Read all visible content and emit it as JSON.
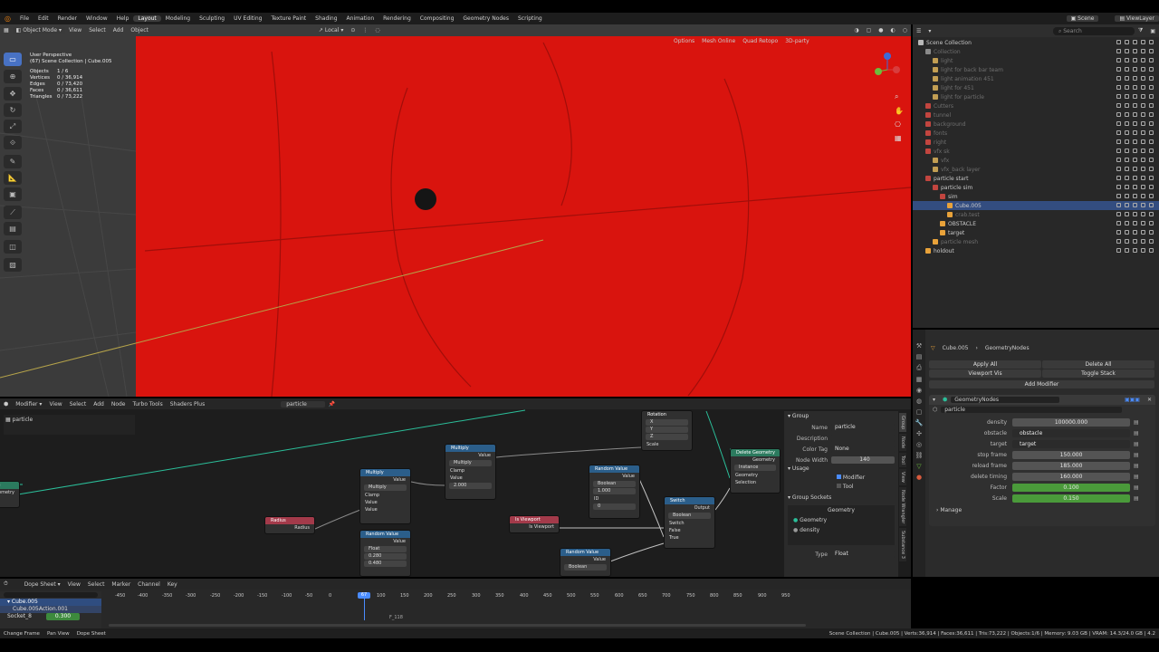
{
  "menu": {
    "items": [
      "File",
      "Edit",
      "Render",
      "Window",
      "Help"
    ]
  },
  "workspaces": [
    "Layout",
    "Modeling",
    "Sculpting",
    "UV Editing",
    "Texture Paint",
    "Shading",
    "Animation",
    "Rendering",
    "Compositing",
    "Geometry Nodes",
    "Scripting"
  ],
  "active_workspace": "Layout",
  "top_right": {
    "scene": "Scene",
    "view_layer": "ViewLayer"
  },
  "viewport": {
    "mode": "Object Mode",
    "menus": [
      "View",
      "Select",
      "Add",
      "Object"
    ],
    "orientation": "Local",
    "right_buttons": [
      "Options",
      "Mesh Online",
      "Quad Retopo",
      "3D-party"
    ],
    "perspective": "User Perspective",
    "collection": "(67) Scene Collection | Cube.005",
    "stats": [
      [
        "Objects",
        "1 / 6"
      ],
      [
        "Vertices",
        "0 / 36,914"
      ],
      [
        "Edges",
        "0 / 73,420"
      ],
      [
        "Faces",
        "0 / 36,611"
      ],
      [
        "Triangles",
        "0 / 73,222"
      ]
    ],
    "bg_color": "#d9140e"
  },
  "outliner": {
    "search_placeholder": "Search",
    "items": [
      {
        "label": "Scene Collection",
        "indent": 0,
        "muted": false,
        "sel": false,
        "color": "#b8b8b8"
      },
      {
        "label": "Collection",
        "indent": 1,
        "muted": true,
        "sel": false,
        "color": "#8a8a8a"
      },
      {
        "label": "light",
        "indent": 2,
        "muted": true,
        "sel": false,
        "color": "#c29e53"
      },
      {
        "label": "light for back bar team",
        "indent": 2,
        "muted": true,
        "sel": false,
        "color": "#c29e53"
      },
      {
        "label": "light animation 451",
        "indent": 2,
        "muted": true,
        "sel": false,
        "color": "#c29e53"
      },
      {
        "label": "light for 451",
        "indent": 2,
        "muted": true,
        "sel": false,
        "color": "#c29e53"
      },
      {
        "label": "light for particle",
        "indent": 2,
        "muted": true,
        "sel": false,
        "color": "#c29e53"
      },
      {
        "label": "Cutters",
        "indent": 1,
        "muted": true,
        "sel": false,
        "color": "#c2453f"
      },
      {
        "label": "tunnel",
        "indent": 1,
        "muted": true,
        "sel": false,
        "color": "#c2453f"
      },
      {
        "label": "background",
        "indent": 1,
        "muted": true,
        "sel": false,
        "color": "#c2453f"
      },
      {
        "label": "fonts",
        "indent": 1,
        "muted": true,
        "sel": false,
        "color": "#c2453f"
      },
      {
        "label": "right",
        "indent": 1,
        "muted": true,
        "sel": false,
        "color": "#c2453f"
      },
      {
        "label": "vfx sk",
        "indent": 1,
        "muted": true,
        "sel": false,
        "color": "#c2453f"
      },
      {
        "label": "vfx",
        "indent": 2,
        "muted": true,
        "sel": false,
        "color": "#c29e53"
      },
      {
        "label": "vfx_back layer",
        "indent": 2,
        "muted": true,
        "sel": false,
        "color": "#c29e53"
      },
      {
        "label": "particle start",
        "indent": 1,
        "muted": false,
        "sel": false,
        "color": "#c2453f"
      },
      {
        "label": "particle sim",
        "indent": 2,
        "muted": false,
        "sel": false,
        "color": "#c2453f"
      },
      {
        "label": "sim",
        "indent": 3,
        "muted": false,
        "sel": false,
        "color": "#c2453f"
      },
      {
        "label": "Cube.005",
        "indent": 4,
        "muted": false,
        "sel": true,
        "color": "#e8a23a"
      },
      {
        "label": "crab.test",
        "indent": 4,
        "muted": true,
        "sel": false,
        "color": "#e8a23a"
      },
      {
        "label": "OBSTACLE",
        "indent": 3,
        "muted": false,
        "sel": false,
        "color": "#e8a23a"
      },
      {
        "label": "target",
        "indent": 3,
        "muted": false,
        "sel": false,
        "color": "#e8a23a"
      },
      {
        "label": "particle mesh",
        "indent": 2,
        "muted": true,
        "sel": false,
        "color": "#e8a23a"
      },
      {
        "label": "holdout",
        "indent": 1,
        "muted": false,
        "sel": false,
        "color": "#e8a23a"
      }
    ]
  },
  "properties": {
    "object": "Cube.005",
    "modifier_tab": "GeometryNodes",
    "apply_all": "Apply All",
    "delete_all": "Delete All",
    "viewport_vis": "Viewport Vis",
    "toggle_stack": "Toggle Stack",
    "add_modifier": "Add Modifier",
    "modifier_name": "GeometryNodes",
    "node_group": "particle",
    "inputs": [
      {
        "label": "density",
        "value": "100000.000",
        "kind": "num"
      },
      {
        "label": "obstacle",
        "value": "obstacle",
        "kind": "field"
      },
      {
        "label": "target",
        "value": "target",
        "kind": "field"
      },
      {
        "label": "stop frame",
        "value": "150.000",
        "kind": "num"
      },
      {
        "label": "reload frame",
        "value": "185.000",
        "kind": "num"
      },
      {
        "label": "delete timing",
        "value": "160.000",
        "kind": "num"
      },
      {
        "label": "Factor",
        "value": "0.100",
        "kind": "bar"
      },
      {
        "label": "Scale",
        "value": "0.150",
        "kind": "bar"
      }
    ],
    "manage": "Manage"
  },
  "node_editor": {
    "editor_type": "Modifier",
    "menus": [
      "View",
      "Select",
      "Add",
      "Node",
      "Turbo Tools",
      "Shaders Plus"
    ],
    "group": "particle",
    "breadcrumb": "particle",
    "side_panel": {
      "group_header": "Group",
      "name_label": "Name",
      "name_value": "particle",
      "desc_label": "Description",
      "color_tag_label": "Color Tag",
      "color_tag_value": "None",
      "node_width_label": "Node Width",
      "node_width_value": "140",
      "usage": "Usage",
      "modifier": "Modifier",
      "tool": "Tool",
      "sockets_header": "Group Sockets",
      "sockets": [
        "Geometry",
        "Geometry",
        "density"
      ],
      "type_label": "Type",
      "type_value": "Float"
    },
    "tabs": [
      "Group",
      "Node",
      "Tool",
      "View",
      "Node Wrangler",
      "Substance 3"
    ],
    "nodes": {
      "radius": {
        "title": "Radius",
        "out": "Radius"
      },
      "multiply1": {
        "title": "Multiply",
        "out": "Value",
        "op": "Multiply",
        "clamp": "Clamp",
        "v1": "Value",
        "v2": "Value"
      },
      "multiply2": {
        "title": "Multiply",
        "out": "Value",
        "op": "Multiply",
        "clamp": "Clamp",
        "v1": "Value",
        "v2": "Value",
        "v2val": "2.000"
      },
      "random1": {
        "title": "Random Value",
        "out": "Value",
        "type": "Float",
        "min": "Min",
        "minv": "0.280",
        "max": "Max",
        "maxv": "0.480"
      },
      "rotation": {
        "title": "Rotation",
        "x": "X",
        "y": "Y",
        "z": "Z",
        "scale": "Scale"
      },
      "random2": {
        "title": "Random Value",
        "out": "Value",
        "type": "Boolean",
        "prob": "Probability",
        "probv": "1.000",
        "id": "ID",
        "seed": "Seed",
        "seedv": "0"
      },
      "viewport": {
        "title": "Is Viewport",
        "out": "Is Viewport"
      },
      "random3": {
        "title": "Random Value",
        "out": "Value",
        "type": "Boolean"
      },
      "switch": {
        "title": "Switch",
        "out": "Output",
        "type": "Boolean",
        "sw": "Switch",
        "f": "False",
        "t": "True"
      },
      "delete": {
        "title": "Delete Geometry",
        "type": "Instance",
        "geo": "Geometry",
        "sel": "Selection",
        "out": "Geometry"
      },
      "left1": {
        "title": "Scale",
        "out": "Geometry"
      }
    }
  },
  "dopesheet": {
    "mode": "Dope Sheet",
    "menus": [
      "View",
      "Select",
      "Marker",
      "Channel",
      "Key"
    ],
    "summary": "Cube.005",
    "action": "Cube.005Action.001",
    "socket_label": "Socket_8",
    "socket_value": "0.300",
    "frame": "67",
    "frame_marker": "F_118",
    "ticks": [
      "-450",
      "-400",
      "-350",
      "-300",
      "-250",
      "-200",
      "-150",
      "-100",
      "-50",
      "0",
      "100",
      "150",
      "200",
      "250",
      "300",
      "350",
      "400",
      "450",
      "500",
      "550",
      "600",
      "650",
      "700",
      "750",
      "800",
      "850",
      "900",
      "950"
    ]
  },
  "statusbar": {
    "left": [
      "Change Frame",
      "Pan View",
      "Dope Sheet"
    ],
    "right": "Scene Collection | Cube.005 | Verts:36,914 | Faces:36,611 | Tris:73,222 | Objects:1/6 | Memory: 9.03 GB | VRAM: 14.3/24.0 GB | 4.2"
  }
}
